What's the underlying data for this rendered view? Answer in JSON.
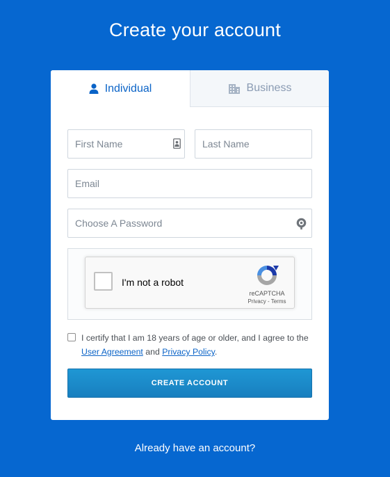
{
  "page": {
    "title": "Create your account",
    "signin_link": "Already have an account?"
  },
  "tabs": [
    {
      "label": "Individual",
      "icon": "person-icon",
      "active": true
    },
    {
      "label": "Business",
      "icon": "building-icon",
      "active": false
    }
  ],
  "form": {
    "first_name": {
      "placeholder": "First Name",
      "value": ""
    },
    "last_name": {
      "placeholder": "Last Name",
      "value": ""
    },
    "email": {
      "placeholder": "Email",
      "value": ""
    },
    "password": {
      "placeholder": "Choose A Password",
      "value": ""
    }
  },
  "captcha": {
    "label": "I'm not a robot",
    "brand": "reCAPTCHA",
    "privacy": "Privacy",
    "separator": " - ",
    "terms": "Terms"
  },
  "agreement": {
    "text_before": "I certify that I am 18 years of age or older, and I agree to the ",
    "user_agreement": "User Agreement",
    "and": " and ",
    "privacy_policy": "Privacy Policy",
    "end": "."
  },
  "submit": {
    "label": "CREATE ACCOUNT"
  },
  "colors": {
    "background": "#0667d0",
    "accent": "#0a63c7",
    "button": "#1f8ccb"
  }
}
